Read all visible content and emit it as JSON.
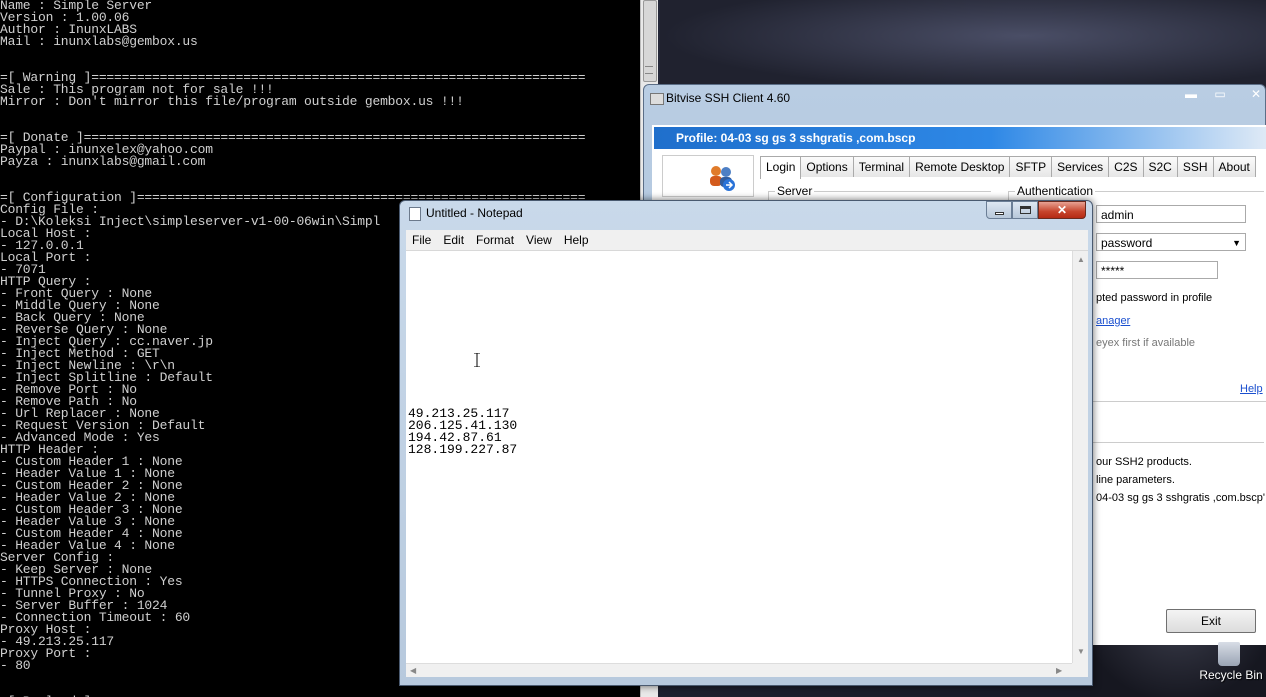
{
  "console": {
    "lines": [
      "Name : Simple Server",
      "Version : 1.00.06",
      "Author : InunxLABS",
      "Mail : inunxlabs@gembox.us",
      "",
      "",
      "=[ Warning ]=================================================================",
      "Sale : This program not for sale !!!",
      "Mirror : Don't mirror this file/program outside gembox.us !!!",
      "",
      "",
      "=[ Donate ]==================================================================",
      "Paypal : inunxelex@yahoo.com",
      "Payza : inunxlabs@gmail.com",
      "",
      "",
      "=[ Configuration ]===========================================================",
      "Config File :",
      "- D:\\Koleksi Inject\\simpleserver-v1-00-06win\\Simpl",
      "Local Host :",
      "- 127.0.0.1",
      "Local Port :",
      "- 7071",
      "HTTP Query :",
      "- Front Query : None",
      "- Middle Query : None",
      "- Back Query : None",
      "- Reverse Query : None",
      "- Inject Query : cc.naver.jp",
      "- Inject Method : GET",
      "- Inject Newline : \\r\\n",
      "- Inject Splitline : Default",
      "- Remove Port : No",
      "- Remove Path : No",
      "- Url Replacer : None",
      "- Request Version : Default",
      "- Advanced Mode : Yes",
      "HTTP Header :",
      "- Custom Header 1 : None",
      "- Header Value 1 : None",
      "- Custom Header 2 : None",
      "- Header Value 2 : None",
      "- Custom Header 3 : None",
      "- Header Value 3 : None",
      "- Custom Header 4 : None",
      "- Header Value 4 : None",
      "Server Config :",
      "- Keep Server : None",
      "- HTTPS Connection : Yes",
      "- Tunnel Proxy : No",
      "- Server Buffer : 1024",
      "- Connection Timeout : 60",
      "Proxy Host :",
      "- 49.213.25.117",
      "Proxy Port :",
      "- 80",
      "",
      "",
      "=[ Payload ]"
    ]
  },
  "bitvise": {
    "title": "Bitvise SSH Client 4.60",
    "profile": "Profile: 04-03 sg gs 3 sshgratis ,com.bscp",
    "tabs": [
      {
        "label": "Login",
        "active": true
      },
      {
        "label": "Options"
      },
      {
        "label": "Terminal"
      },
      {
        "label": "Remote Desktop"
      },
      {
        "label": "SFTP"
      },
      {
        "label": "Services"
      },
      {
        "label": "C2S"
      },
      {
        "label": "S2C"
      },
      {
        "label": "SSH"
      },
      {
        "label": "About"
      }
    ],
    "server_group": "Server",
    "auth_group": "Authentication",
    "username": "admin",
    "method": "password",
    "password_mask": "*****",
    "store_text": "pted password in profile",
    "manager_link": "anager",
    "keyex_text": "eyex first if available",
    "help_link": "Help",
    "log": [
      "our SSH2 products.",
      "line parameters.",
      "04-03 sg gs 3 sshgratis ,com.bscp'."
    ],
    "exit_label": "Exit",
    "controls": {
      "minimize": "▬",
      "maximize": "▭",
      "close": "✕"
    }
  },
  "notepad": {
    "title": "Untitled - Notepad",
    "menu": [
      "File",
      "Edit",
      "Format",
      "View",
      "Help"
    ],
    "lines": [
      "49.213.25.117",
      "206.125.41.130",
      "194.42.87.61",
      "128.199.227.87"
    ],
    "close_glyph": "✕"
  },
  "desktop": {
    "recycle_label": "Recycle Bin"
  }
}
